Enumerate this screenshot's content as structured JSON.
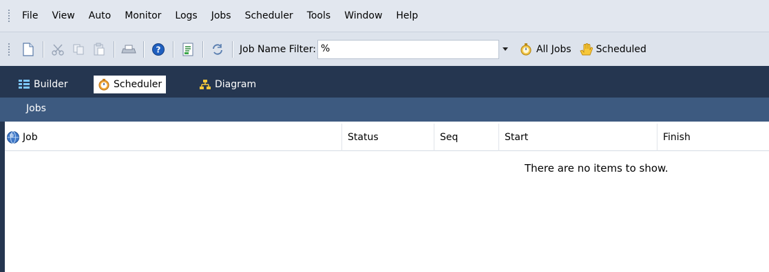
{
  "menu": {
    "items": [
      "File",
      "View",
      "Auto",
      "Monitor",
      "Logs",
      "Jobs",
      "Scheduler",
      "Tools",
      "Window",
      "Help"
    ]
  },
  "toolbar": {
    "icons": [
      "new-document-icon",
      "cut-icon",
      "copy-icon",
      "paste-icon",
      "print-icon",
      "help-icon",
      "report-icon",
      "refresh-icon"
    ],
    "filter_label": "Job Name Filter:",
    "filter_value": "%",
    "all_jobs_label": "All Jobs",
    "scheduled_label": "Scheduled"
  },
  "tabs": [
    {
      "label": "Builder",
      "icon": "builder-grid-icon",
      "active": false
    },
    {
      "label": "Scheduler",
      "icon": "stopwatch-icon",
      "active": true
    },
    {
      "label": "Diagram",
      "icon": "diagram-icon",
      "active": false
    }
  ],
  "panel": {
    "title": "Jobs"
  },
  "list": {
    "columns": [
      "Job",
      "Status",
      "Seq",
      "Start",
      "Finish"
    ],
    "empty_message": "There are no items to show."
  },
  "colors": {
    "navy_dark": "#253650",
    "navy_panel": "#3d5a80",
    "toolbar_bg": "#dde3ec",
    "menubar_bg": "#e2e7ef"
  }
}
